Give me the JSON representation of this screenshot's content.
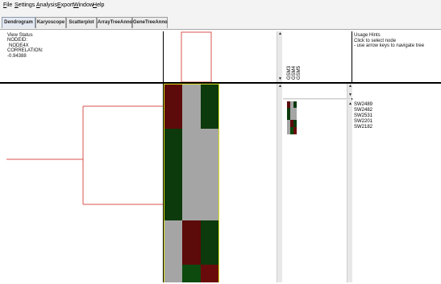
{
  "menu": {
    "items": [
      {
        "label": "File"
      },
      {
        "label": "Settings"
      },
      {
        "label": "Analysis"
      },
      {
        "label": "Export"
      },
      {
        "label": "Window"
      },
      {
        "label": "Help"
      }
    ]
  },
  "tabs": [
    {
      "label": "Dendrogram",
      "active": true
    },
    {
      "label": "Karyoscope",
      "active": false
    },
    {
      "label": "Scatterplot",
      "active": false
    },
    {
      "label": "ArrayTreeAnno",
      "active": false
    },
    {
      "label": "GeneTreeAnno",
      "active": false
    }
  ],
  "view_status": {
    "title": "View Status",
    "node_id": "NODEID:",
    "node_value": "NODE4X",
    "correlation_label": "CORRELATION:",
    "correlation_value": "-0.94388"
  },
  "usage_hints": {
    "title": "Usage Hints",
    "line1": "Click to select node",
    "line2": "- use arrow keys to navigate tree"
  },
  "array_labels": [
    "GSM3",
    "GSM4",
    "GSM5"
  ],
  "gene_labels": [
    "SW2489",
    "SW2482",
    "SW2531",
    "SW2201",
    "SW2182"
  ],
  "colors": {
    "tree_line": "#d9534f",
    "selection_outline": "#e0e020",
    "red": "#5c0a0a",
    "green": "#0c3a0c",
    "gray": "#a5a5a5",
    "bright_red": "#6a0b0b",
    "bright_green": "#0d4a0d"
  }
}
